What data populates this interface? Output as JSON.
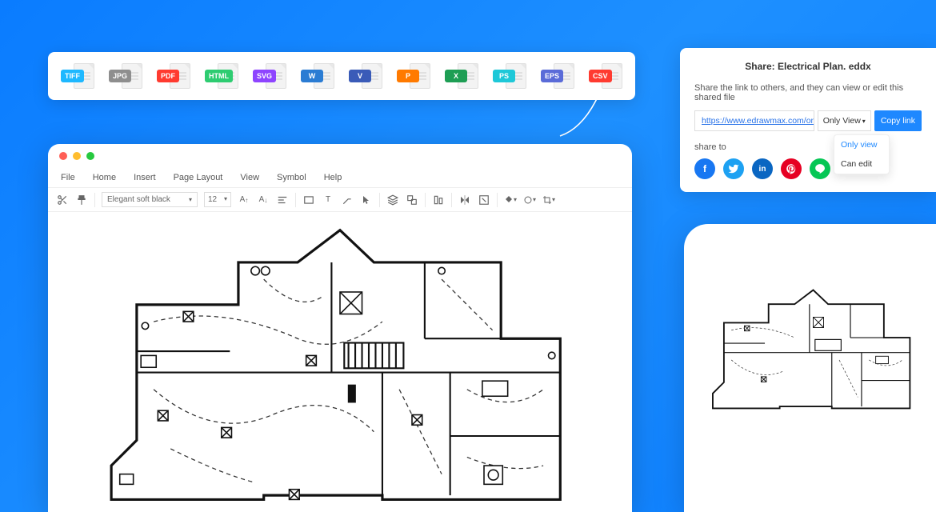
{
  "export_formats": [
    {
      "label": "TIFF",
      "color": "#1eb8ff"
    },
    {
      "label": "JPG",
      "color": "#8e8e8e"
    },
    {
      "label": "PDF",
      "color": "#ff3b30"
    },
    {
      "label": "HTML",
      "color": "#2ecc71"
    },
    {
      "label": "SVG",
      "color": "#8e44ff"
    },
    {
      "label": "W",
      "color": "#2b7cd3"
    },
    {
      "label": "V",
      "color": "#3a5bb8"
    },
    {
      "label": "P",
      "color": "#ff7a00"
    },
    {
      "label": "X",
      "color": "#1e9e54"
    },
    {
      "label": "PS",
      "color": "#1ec8d8"
    },
    {
      "label": "EPS",
      "color": "#5a6bd8"
    },
    {
      "label": "CSV",
      "color": "#ff3b30"
    }
  ],
  "editor": {
    "menu": [
      "File",
      "Home",
      "Insert",
      "Page Layout",
      "View",
      "Symbol",
      "Help"
    ],
    "font_name": "Elegant soft black",
    "font_size": "12"
  },
  "share": {
    "title": "Share: Electrical Plan. eddx",
    "desc": "Share the link to others, and they can view or edit this shared file",
    "url": "https://www.edrawmax.com/online/files",
    "perm_selected": "Only View",
    "copy": "Copy link",
    "perm_options": [
      "Only view",
      "Can edit"
    ],
    "share_to": "share to",
    "socials": [
      {
        "name": "facebook",
        "bg": "#1877f2",
        "glyph": "f"
      },
      {
        "name": "twitter",
        "bg": "#1da1f2",
        "glyph": "t"
      },
      {
        "name": "linkedin",
        "bg": "#0a66c2",
        "glyph": "in"
      },
      {
        "name": "pinterest",
        "bg": "#e60023",
        "glyph": "p"
      },
      {
        "name": "line",
        "bg": "#06c755",
        "glyph": "L"
      }
    ]
  }
}
